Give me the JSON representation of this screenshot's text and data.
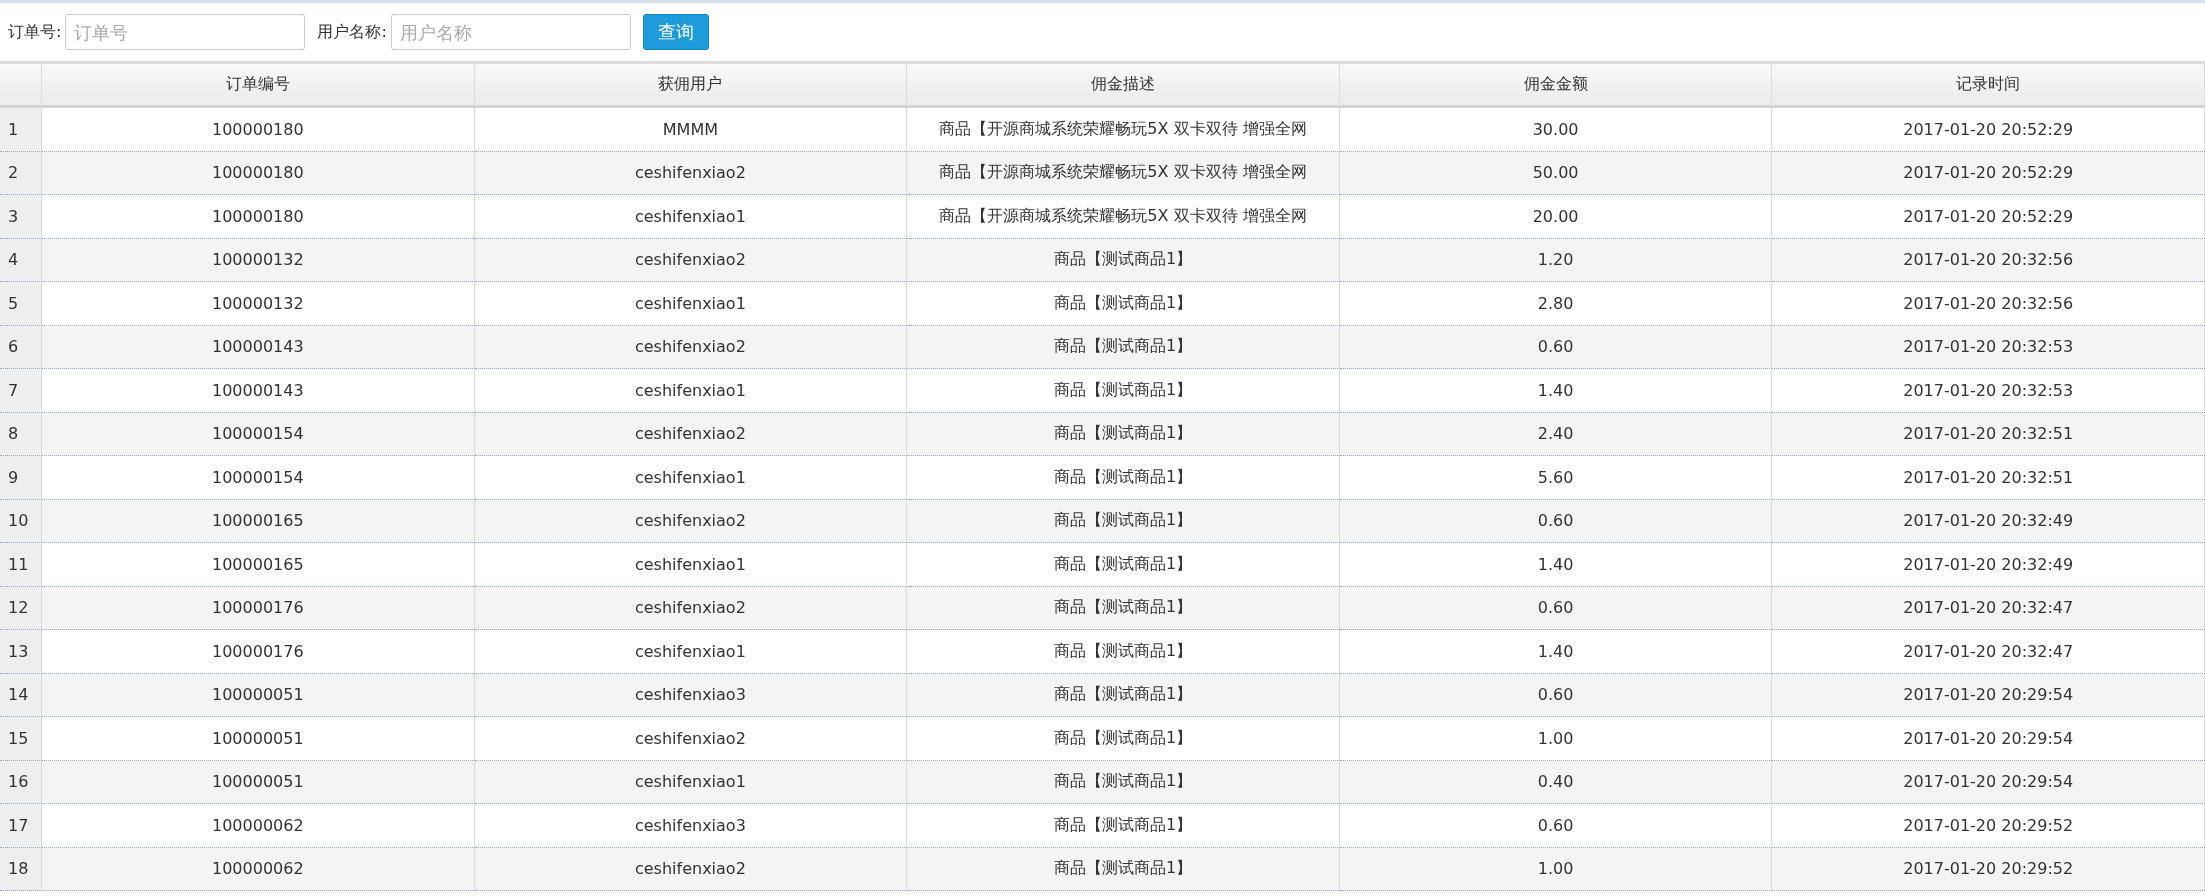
{
  "search": {
    "fields": [
      {
        "label": "订单号:",
        "placeholder": "订单号"
      },
      {
        "label": "用户名称:",
        "placeholder": "用户名称"
      }
    ],
    "button": "查询"
  },
  "table": {
    "columns": [
      "订单编号",
      "获佣用户",
      "佣金描述",
      "佣金金额",
      "记录时间"
    ],
    "rows": [
      {
        "number": "1",
        "cells": [
          "100000180",
          "MMMM",
          "商品【开源商城系统荣耀畅玩5X 双卡双待 增强全网",
          "30.00",
          "2017-01-20 20:52:29"
        ]
      },
      {
        "number": "2",
        "cells": [
          "100000180",
          "ceshifenxiao2",
          "商品【开源商城系统荣耀畅玩5X 双卡双待 增强全网",
          "50.00",
          "2017-01-20 20:52:29"
        ]
      },
      {
        "number": "3",
        "cells": [
          "100000180",
          "ceshifenxiao1",
          "商品【开源商城系统荣耀畅玩5X 双卡双待 增强全网",
          "20.00",
          "2017-01-20 20:52:29"
        ]
      },
      {
        "number": "4",
        "cells": [
          "100000132",
          "ceshifenxiao2",
          "商品【测试商品1】",
          "1.20",
          "2017-01-20 20:32:56"
        ]
      },
      {
        "number": "5",
        "cells": [
          "100000132",
          "ceshifenxiao1",
          "商品【测试商品1】",
          "2.80",
          "2017-01-20 20:32:56"
        ]
      },
      {
        "number": "6",
        "cells": [
          "100000143",
          "ceshifenxiao2",
          "商品【测试商品1】",
          "0.60",
          "2017-01-20 20:32:53"
        ]
      },
      {
        "number": "7",
        "cells": [
          "100000143",
          "ceshifenxiao1",
          "商品【测试商品1】",
          "1.40",
          "2017-01-20 20:32:53"
        ]
      },
      {
        "number": "8",
        "cells": [
          "100000154",
          "ceshifenxiao2",
          "商品【测试商品1】",
          "2.40",
          "2017-01-20 20:32:51"
        ]
      },
      {
        "number": "9",
        "cells": [
          "100000154",
          "ceshifenxiao1",
          "商品【测试商品1】",
          "5.60",
          "2017-01-20 20:32:51"
        ]
      },
      {
        "number": "10",
        "cells": [
          "100000165",
          "ceshifenxiao2",
          "商品【测试商品1】",
          "0.60",
          "2017-01-20 20:32:49"
        ]
      },
      {
        "number": "11",
        "cells": [
          "100000165",
          "ceshifenxiao1",
          "商品【测试商品1】",
          "1.40",
          "2017-01-20 20:32:49"
        ]
      },
      {
        "number": "12",
        "cells": [
          "100000176",
          "ceshifenxiao2",
          "商品【测试商品1】",
          "0.60",
          "2017-01-20 20:32:47"
        ]
      },
      {
        "number": "13",
        "cells": [
          "100000176",
          "ceshifenxiao1",
          "商品【测试商品1】",
          "1.40",
          "2017-01-20 20:32:47"
        ]
      },
      {
        "number": "14",
        "cells": [
          "100000051",
          "ceshifenxiao3",
          "商品【测试商品1】",
          "0.60",
          "2017-01-20 20:29:54"
        ]
      },
      {
        "number": "15",
        "cells": [
          "100000051",
          "ceshifenxiao2",
          "商品【测试商品1】",
          "1.00",
          "2017-01-20 20:29:54"
        ]
      },
      {
        "number": "16",
        "cells": [
          "100000051",
          "ceshifenxiao1",
          "商品【测试商品1】",
          "0.40",
          "2017-01-20 20:29:54"
        ]
      },
      {
        "number": "17",
        "cells": [
          "100000062",
          "ceshifenxiao3",
          "商品【测试商品1】",
          "0.60",
          "2017-01-20 20:29:52"
        ]
      },
      {
        "number": "18",
        "cells": [
          "100000062",
          "ceshifenxiao2",
          "商品【测试商品1】",
          "1.00",
          "2017-01-20 20:29:52"
        ]
      }
    ]
  }
}
